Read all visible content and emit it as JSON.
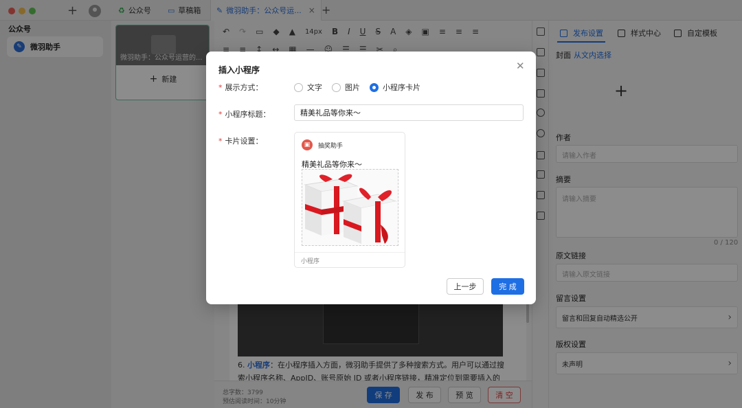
{
  "window": {
    "tabs": [
      {
        "label": "公众号",
        "icon": "recycle-icon"
      },
      {
        "label": "草稿箱",
        "icon": "folder-icon"
      },
      {
        "label": "微羽助手：公众号运...",
        "icon": "edit-icon"
      }
    ]
  },
  "sidebar": {
    "title": "公众号",
    "items": [
      {
        "label": "微羽助手",
        "icon": "pen-icon"
      }
    ]
  },
  "drafts": {
    "card_caption": "微羽助手：公众号运营的...",
    "new_label": "新建"
  },
  "toolbar": {
    "font_size": "14px"
  },
  "editor": {
    "paragraph_number": "6.",
    "paragraph_bold": "小程序",
    "paragraph_text": "：在小程序插入方面，微羽助手提供了多种搜索方式。用户可以通过搜索小程序名称、AppID、账号原始 ID 或者小程序链接，精准定位到需要插入的小程序。并且，在插入小程序时，用户可以根据文章的排版和需求，设置文字、图片和卡片等多种形式，使小程序与文章内容完美融合。",
    "word_count": "总字数：3799",
    "read_time": "预估阅读时间：10分钟",
    "buttons": {
      "save": "保 存",
      "publish": "发 布",
      "preview": "预 览",
      "clear": "清 空"
    }
  },
  "right_panel": {
    "tabs": [
      "发布设置",
      "样式中心",
      "自定模板"
    ],
    "cover_label": "封面",
    "cover_link": "从文内选择",
    "author_label": "作者",
    "author_placeholder": "请输入作者",
    "summary_label": "摘要",
    "summary_placeholder": "请输入摘要",
    "summary_counter": "0 / 120",
    "source_label": "原文链接",
    "source_placeholder": "请输入原文链接",
    "comment_label": "留言设置",
    "comment_value": "留言和回复自动精选公开",
    "copyright_label": "版权设置",
    "copyright_value": "未声明"
  },
  "modal": {
    "title": "插入小程序",
    "display_label": "展示方式：",
    "display_options": [
      "文字",
      "图片",
      "小程序卡片"
    ],
    "display_selected": "小程序卡片",
    "title_label": "小程序标题：",
    "title_value": "精美礼品等你来～",
    "card_label": "卡片设置：",
    "card": {
      "app_name": "抽奖助手",
      "title": "精美礼品等你来～",
      "footer": "小程序"
    },
    "prev_button": "上一步",
    "done_button": "完 成"
  }
}
